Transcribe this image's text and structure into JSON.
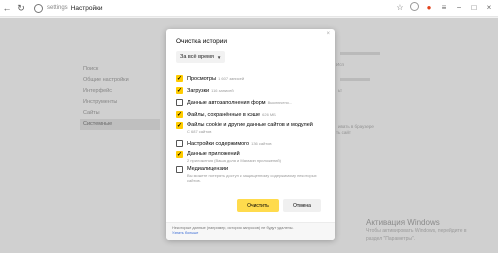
{
  "browser": {
    "url_scheme": "settings",
    "page_title": "Настройки",
    "icons": [
      "back-icon",
      "reload-icon",
      "site-icon",
      "favorites-icon",
      "download-icon",
      "extensions-icon",
      "menu-icon",
      "minimize-icon",
      "maximize-icon",
      "close-icon"
    ]
  },
  "sidebar": {
    "items": [
      {
        "label": "Поиск"
      },
      {
        "label": "Общие настройки"
      },
      {
        "label": "Интерфейс"
      },
      {
        "label": "Инструменты"
      },
      {
        "label": "Сайты"
      },
      {
        "label": "Системные"
      }
    ]
  },
  "background_text": {
    "line1": "Исп",
    "line2": "ьт",
    "line3": "ть сайт",
    "line4": "ивать в браузере"
  },
  "dialog": {
    "title": "Очистка истории",
    "close_label": "×",
    "range": "За всё время",
    "options": [
      {
        "label": "Просмотры",
        "extra": "1 607 записей",
        "checked": true,
        "sub": ""
      },
      {
        "label": "Загрузки",
        "extra": "116 записей",
        "checked": true,
        "sub": ""
      },
      {
        "label": "Данные автозаполнения форм",
        "extra": "Выключено...",
        "checked": false,
        "sub": ""
      },
      {
        "label": "Файлы, сохранённые в кэше",
        "extra": "626 МБ",
        "checked": true,
        "sub": ""
      },
      {
        "label": "Файлы cookie и другие данные сайтов и модулей",
        "extra": "",
        "checked": true,
        "sub": "С 687 сайтов"
      },
      {
        "label": "Настройки содержимого",
        "extra": "136 сайтов",
        "checked": false,
        "sub": ""
      },
      {
        "label": "Данные приложений",
        "extra": "",
        "checked": true,
        "sub": "2 приложения (Ваша доля и Магазин приложений)"
      },
      {
        "label": "Медиалицензии",
        "extra": "",
        "checked": false,
        "sub": "Вы можете потерять доступ к защищенному содержимому некоторых сайтов."
      }
    ],
    "clear_button": "Очистить",
    "cancel_button": "Отмена",
    "footer_text": "Некоторые данные (например, история запросов) не будут удалены.",
    "footer_link": "Узнать больше"
  },
  "watermark": {
    "title": "Активация Windows",
    "line1": "Чтобы активировать Windows, перейдите в",
    "line2": "раздел \"Параметры\"."
  }
}
